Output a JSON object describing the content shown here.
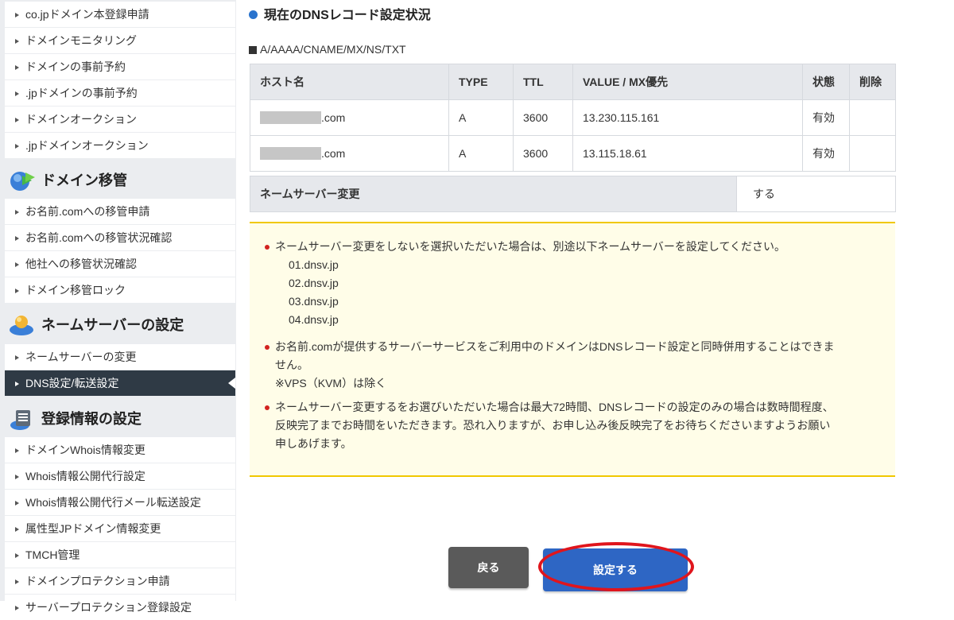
{
  "sidebar": {
    "group1": [
      "co.jpドメイン本登録申請",
      "ドメインモニタリング",
      "ドメインの事前予約",
      ".jpドメインの事前予約",
      "ドメインオークション",
      ".jpドメインオークション"
    ],
    "transfer_title": "ドメイン移管",
    "transfer_items": [
      "お名前.comへの移管申請",
      "お名前.comへの移管状況確認",
      "他社への移管状況確認",
      "ドメイン移管ロック"
    ],
    "ns_title": "ネームサーバーの設定",
    "ns_items": [
      "ネームサーバーの変更",
      "DNS設定/転送設定"
    ],
    "reg_title": "登録情報の設定",
    "reg_items": [
      "ドメインWhois情報変更",
      "Whois情報公開代行設定",
      "Whois情報公開代行メール転送設定",
      "属性型JPドメイン情報変更",
      "TMCH管理",
      "ドメインプロテクション申請",
      "サーバープロテクション登録設定"
    ]
  },
  "main": {
    "title": "現在のDNSレコード設定状況",
    "subtitle": "A/AAAA/CNAME/MX/NS/TXT",
    "table": {
      "headers": [
        "ホスト名",
        "TYPE",
        "TTL",
        "VALUE / MX優先",
        "状態",
        "削除"
      ],
      "rows": [
        {
          "host_suffix": ".com",
          "type": "A",
          "ttl": "3600",
          "value": "13.230.115.161",
          "status": "有効"
        },
        {
          "host_suffix": ".com",
          "type": "A",
          "ttl": "3600",
          "value": "13.115.18.61",
          "status": "有効"
        }
      ]
    },
    "ns_change": {
      "label": "ネームサーバー変更",
      "value": "する"
    },
    "notice": {
      "item1": "ネームサーバー変更をしないを選択いただいた場合は、別途以下ネームサーバーを設定してください。",
      "nameservers": [
        "01.dnsv.jp",
        "02.dnsv.jp",
        "03.dnsv.jp",
        "04.dnsv.jp"
      ],
      "item2_line1": "お名前.comが提供するサーバーサービスをご利用中のドメインはDNSレコード設定と同時併用することはできま",
      "item2_line2": "せん。",
      "item2_note": "※VPS（KVM）は除く",
      "item3_line1": "ネームサーバー変更するをお選びいただいた場合は最大72時間、DNSレコードの設定のみの場合は数時間程度、",
      "item3_line2": "反映完了までお時間をいただきます。恐れ入りますが、お申し込み後反映完了をお待ちくださいますようお願い",
      "item3_line3": "申しあげます。"
    },
    "buttons": {
      "back": "戻る",
      "submit": "設定する"
    }
  },
  "colors": {
    "accent": "#2e66c4",
    "active_nav": "#2f3a45",
    "highlight_circle": "#e0151c",
    "notice_border": "#f0c800"
  }
}
